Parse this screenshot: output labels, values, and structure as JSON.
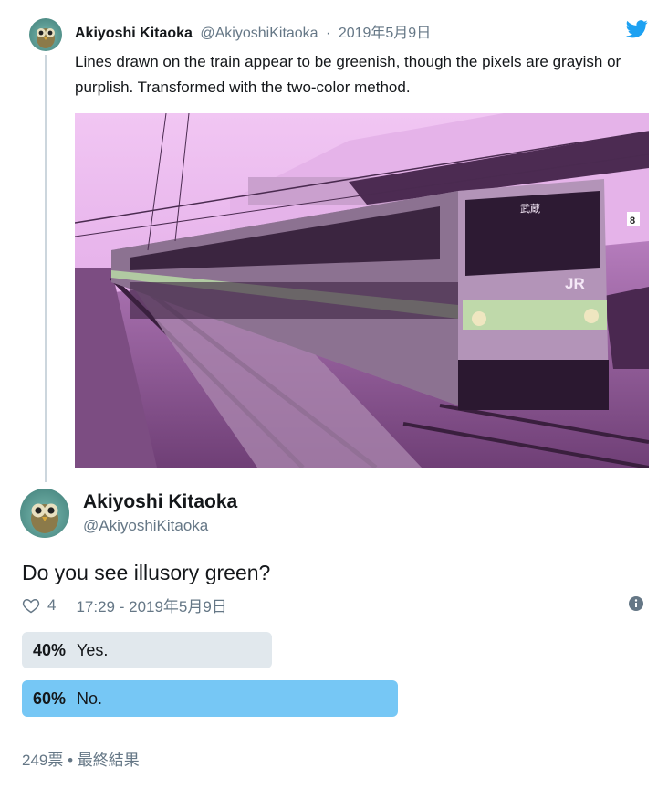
{
  "quoted": {
    "name": "Akiyoshi Kitaoka",
    "handle": "@AkiyoshiKitaoka",
    "separator": "·",
    "date": "2019年5月9日",
    "text": "Lines drawn on the train appear to be greenish, though the pixels are grayish or purplish. Transformed with the two-color method."
  },
  "main": {
    "name": "Akiyoshi Kitaoka",
    "handle": "@AkiyoshiKitaoka",
    "text": "Do you see illusory green?",
    "likes": "4",
    "timestamp": "17:29 - 2019年5月9日"
  },
  "poll": {
    "options": [
      {
        "percent": "40%",
        "label": "Yes.",
        "value": 40
      },
      {
        "percent": "60%",
        "label": "No.",
        "value": 60
      }
    ],
    "footer": "249票 • 最終結果"
  },
  "photo_text": {
    "badge": "JR",
    "dest": "武蔵",
    "platform": "8"
  },
  "colors": {
    "brand_blue": "#1da1f2",
    "text_primary": "#14171a",
    "text_secondary": "#657786",
    "poll_leader": "#76c7f5",
    "poll_other": "#e1e8ed",
    "photo_tint": "#d88ee0"
  },
  "icons": [
    "twitter-bird-icon",
    "heart-icon",
    "info-icon"
  ]
}
